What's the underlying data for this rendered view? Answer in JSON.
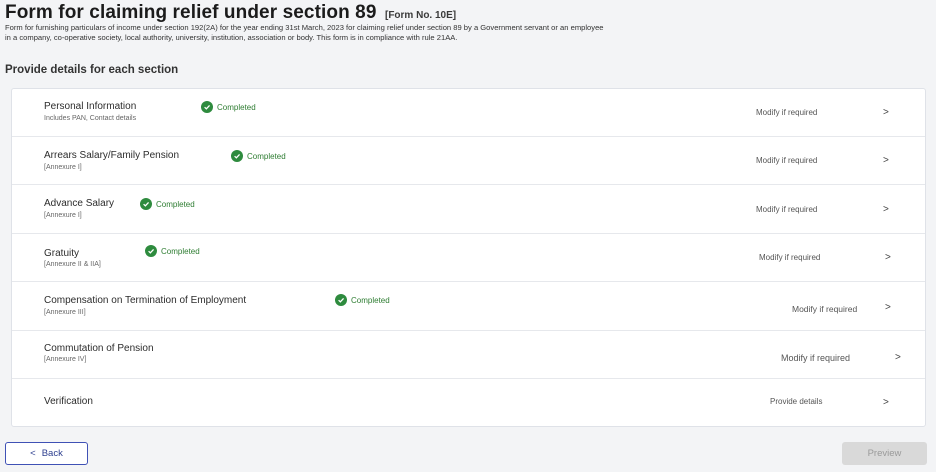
{
  "header": {
    "title": "Form for claiming relief under section 89",
    "form_no": "[Form No. 10E]",
    "description": "Form for furnishing particulars of income under section 192(2A) for the year ending 31st March, 2023 for claiming relief under section 89 by a Government servant or an employee in a company, co-operative society, local authority, university, institution, association or body. This form is in compliance with rule 21AA."
  },
  "section_heading": "Provide details for each section",
  "sections": [
    {
      "title": "Personal Information",
      "subtitle": "Includes PAN, Contact details",
      "status": "Completed",
      "action": "Modify if required"
    },
    {
      "title": "Arrears Salary/Family Pension",
      "subtitle": "[Annexure I]",
      "status": "Completed",
      "action": "Modify if required"
    },
    {
      "title": "Advance Salary",
      "subtitle": "[Annexure I]",
      "status": "Completed",
      "action": "Modify if required"
    },
    {
      "title": "Gratuity",
      "subtitle": "[Annexure II & IIA]",
      "status": "Completed",
      "action": "Modify if required"
    },
    {
      "title": "Compensation on Termination of Employment",
      "subtitle": "[Annexure III]",
      "status": "Completed",
      "action": "Modify if required"
    },
    {
      "title": "Commutation of Pension",
      "subtitle": "[Annexure IV]",
      "status": "",
      "action": "Modify if required"
    },
    {
      "title": "Verification",
      "subtitle": "",
      "status": "",
      "action": "Provide details"
    }
  ],
  "footer": {
    "back_label": "Back",
    "back_icon": "<",
    "preview_label": "Preview"
  },
  "icons": {
    "chevron": ">"
  },
  "colors": {
    "completed_green": "#2e8b3e",
    "primary_blue": "#3f51b5",
    "disabled_gray": "#d9d9d9"
  }
}
